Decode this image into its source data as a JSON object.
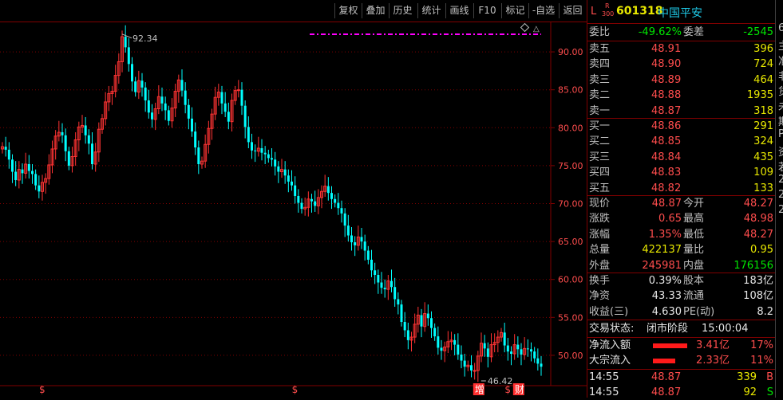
{
  "toolbar": {
    "buttons": [
      "复权",
      "叠加",
      "历史",
      "统计",
      "画线",
      "F10",
      "标记",
      "-自选",
      "返回"
    ]
  },
  "stock": {
    "prefix": "L",
    "tag_top": "R",
    "tag_bottom": "300",
    "code": "601318",
    "name": "中国平安"
  },
  "quote": {
    "weibi": {
      "label": "委比",
      "value": "-49.62%",
      "label2": "委差",
      "value2": "-2545"
    },
    "sell": [
      {
        "label": "卖五",
        "price": "48.91",
        "vol": "396"
      },
      {
        "label": "卖四",
        "price": "48.90",
        "vol": "724"
      },
      {
        "label": "卖三",
        "price": "48.89",
        "vol": "464"
      },
      {
        "label": "卖二",
        "price": "48.88",
        "vol": "1935"
      },
      {
        "label": "卖一",
        "price": "48.87",
        "vol": "318"
      }
    ],
    "buy": [
      {
        "label": "买一",
        "price": "48.86",
        "vol": "291"
      },
      {
        "label": "买二",
        "price": "48.85",
        "vol": "324"
      },
      {
        "label": "买三",
        "price": "48.84",
        "vol": "435"
      },
      {
        "label": "买四",
        "price": "48.83",
        "vol": "109"
      },
      {
        "label": "买五",
        "price": "48.82",
        "vol": "133"
      }
    ],
    "stats": [
      {
        "l1": "现价",
        "v1": "48.87",
        "l2": "今开",
        "v2": "48.27"
      },
      {
        "l1": "涨跌",
        "v1": "0.65",
        "l2": "最高",
        "v2": "48.98"
      },
      {
        "l1": "涨幅",
        "v1": "1.35%",
        "l2": "最低",
        "v2": "48.27"
      },
      {
        "l1": "总量",
        "v1": "422137",
        "l2": "量比",
        "v2": "0.95"
      },
      {
        "l1": "外盘",
        "v1": "245981",
        "l2": "内盘",
        "v2": "176156"
      }
    ],
    "stats2": [
      {
        "l1": "换手",
        "v1": "0.39%",
        "l2": "股本",
        "v2": "183亿"
      },
      {
        "l1": "净资",
        "v1": "43.33",
        "l2": "流通",
        "v2": "108亿"
      },
      {
        "l1": "收益(三)",
        "v1": "4.630",
        "l2": "PE(动)",
        "v2": "8.2"
      }
    ],
    "status": {
      "label": "交易状态:",
      "value": "闭市阶段",
      "time": "15:00:04"
    },
    "flows": [
      {
        "label": "净流入额",
        "amount": "3.41亿",
        "pct": "17%",
        "bar": 0.17
      },
      {
        "label": "大宗流入",
        "amount": "2.33亿",
        "pct": "11%",
        "bar": 0.11
      }
    ],
    "ticks": [
      {
        "time": "14:55",
        "price": "48.87",
        "vol": "339",
        "side": "B"
      },
      {
        "time": "14:55",
        "price": "48.87",
        "vol": "92",
        "side": "S"
      }
    ]
  },
  "edge_chars": [
    "6",
    "主",
    "准",
    "非",
    "货",
    "未",
    "期",
    "P",
    "资",
    "若",
    "2",
    "2",
    "2"
  ],
  "chart_data": {
    "type": "candlestick",
    "ylim": [
      46,
      94
    ],
    "yticks": [
      50,
      55,
      60,
      65,
      70,
      75,
      80,
      85,
      90
    ],
    "ytick_labels": [
      "50.00",
      "55.00",
      "60.00",
      "65.00",
      "70.00",
      "75.00",
      "80.00",
      "85.00",
      "90.00"
    ],
    "annotations": {
      "high_label": "92.34",
      "high_value": 92.34,
      "low_label": "46.42",
      "low_value": 46.42
    },
    "markers": [
      {
        "text": "$",
        "index": 12
      },
      {
        "text": "$",
        "index": 88
      },
      {
        "text": "增",
        "index": 143
      },
      {
        "text": "$",
        "index": 152
      },
      {
        "text": "财",
        "index": 155
      }
    ],
    "close": [
      77.5,
      77.1,
      75.8,
      74.2,
      73.1,
      74.5,
      74.0,
      75.2,
      74.3,
      73.9,
      72.4,
      71.6,
      72.8,
      73.3,
      75.1,
      77.2,
      78.9,
      79.4,
      79.0,
      76.9,
      75.0,
      76.2,
      78.4,
      80.1,
      80.3,
      79.0,
      77.9,
      75.2,
      76.8,
      79.8,
      81.2,
      83.4,
      84.5,
      84.8,
      86.9,
      88.7,
      92.0,
      90.6,
      88.4,
      86.1,
      84.7,
      86.2,
      85.3,
      83.6,
      82.0,
      81.1,
      82.5,
      84.1,
      83.2,
      82.3,
      80.9,
      82.6,
      84.8,
      86.3,
      84.9,
      83.0,
      81.2,
      79.5,
      77.4,
      75.2,
      75.6,
      77.8,
      79.9,
      81.8,
      84.0,
      84.7,
      83.2,
      82.1,
      80.8,
      83.6,
      84.9,
      85.0,
      82.9,
      80.1,
      78.1,
      77.0,
      76.9,
      77.3,
      76.7,
      76.5,
      76.0,
      75.8,
      74.9,
      74.2,
      74.5,
      73.7,
      72.9,
      72.4,
      71.0,
      70.1,
      69.3,
      69.5,
      70.6,
      70.3,
      69.7,
      70.8,
      71.6,
      72.3,
      71.4,
      70.6,
      70.1,
      69.4,
      68.7,
      67.1,
      65.8,
      64.9,
      64.5,
      65.6,
      65.0,
      63.8,
      62.6,
      61.2,
      60.6,
      59.6,
      58.9,
      58.7,
      59.8,
      59.0,
      57.4,
      56.7,
      54.4,
      53.3,
      52.0,
      52.4,
      54.1,
      55.3,
      53.8,
      55.5,
      54.9,
      53.6,
      52.5,
      51.0,
      50.6,
      51.1,
      51.8,
      52.0,
      51.4,
      50.1,
      49.3,
      48.5,
      48.7,
      48.0,
      48.0,
      49.9,
      51.6,
      50.9,
      49.8,
      51.4,
      51.7,
      52.4,
      53.0,
      51.3,
      50.5,
      50.2,
      51.4,
      50.8,
      50.1,
      50.9,
      50.8,
      50.5,
      49.6,
      48.9,
      48.5
    ],
    "open": [
      77.2,
      77.5,
      77.1,
      75.8,
      74.2,
      73.1,
      74.5,
      74.0,
      75.2,
      74.3,
      73.9,
      72.4,
      71.6,
      72.8,
      73.3,
      75.1,
      77.2,
      78.9,
      79.4,
      79.0,
      76.9,
      75.0,
      76.2,
      78.4,
      80.1,
      80.3,
      79.0,
      77.9,
      75.2,
      76.8,
      79.8,
      81.2,
      83.4,
      84.5,
      84.8,
      86.9,
      88.7,
      92.0,
      90.6,
      88.4,
      86.1,
      84.7,
      86.2,
      85.3,
      83.6,
      82.0,
      81.1,
      82.5,
      84.1,
      83.2,
      82.3,
      80.9,
      82.6,
      84.8,
      86.3,
      84.9,
      83.0,
      81.2,
      79.5,
      77.4,
      75.2,
      75.6,
      77.8,
      79.9,
      81.8,
      84.0,
      84.7,
      83.2,
      82.1,
      80.8,
      83.6,
      84.9,
      85.0,
      82.9,
      80.1,
      78.1,
      77.0,
      76.9,
      77.3,
      76.7,
      76.5,
      76.0,
      75.8,
      74.9,
      74.2,
      74.5,
      73.7,
      72.9,
      72.4,
      71.0,
      70.1,
      69.3,
      69.5,
      70.6,
      70.3,
      69.7,
      70.8,
      71.6,
      72.3,
      71.4,
      70.6,
      70.1,
      69.4,
      68.7,
      67.1,
      65.8,
      64.9,
      64.5,
      65.6,
      65.0,
      63.8,
      62.6,
      61.2,
      60.6,
      59.6,
      58.9,
      58.7,
      59.8,
      59.0,
      57.4,
      56.7,
      54.4,
      53.3,
      52.0,
      52.4,
      54.1,
      55.3,
      53.8,
      55.5,
      54.9,
      53.6,
      52.5,
      51.0,
      50.6,
      51.1,
      51.8,
      52.0,
      51.4,
      50.1,
      49.3,
      48.5,
      48.7,
      48.0,
      48.0,
      49.9,
      51.6,
      50.9,
      49.8,
      51.4,
      51.7,
      52.4,
      53.0,
      51.3,
      50.5,
      50.2,
      51.4,
      50.8,
      50.1,
      50.9,
      50.8,
      50.5,
      49.6,
      48.9
    ],
    "high_index": 36,
    "low_index": 143
  }
}
